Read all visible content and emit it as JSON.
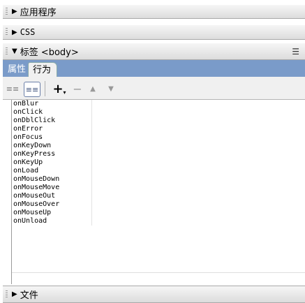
{
  "panels": {
    "applications": {
      "title": "应用程序"
    },
    "css": {
      "title": "CSS"
    },
    "tag": {
      "title": "标签 <body>"
    },
    "files": {
      "title": "文件"
    }
  },
  "tabs": [
    {
      "label": "属性",
      "active": false
    },
    {
      "label": "行为",
      "active": true
    }
  ],
  "toolbar": {
    "add_glyph": "+",
    "remove_glyph": "−",
    "up_glyph": "▲",
    "down_glyph": "▼"
  },
  "events": [
    "onBlur",
    "onClick",
    "onDblClick",
    "onError",
    "onFocus",
    "onKeyDown",
    "onKeyPress",
    "onKeyUp",
    "onLoad",
    "onMouseDown",
    "onMouseMove",
    "onMouseOut",
    "onMouseOver",
    "onMouseUp",
    "onUnload"
  ],
  "colors": {
    "tab_bar": "#7a9bc9",
    "panel_header": "#e8e8e8"
  }
}
